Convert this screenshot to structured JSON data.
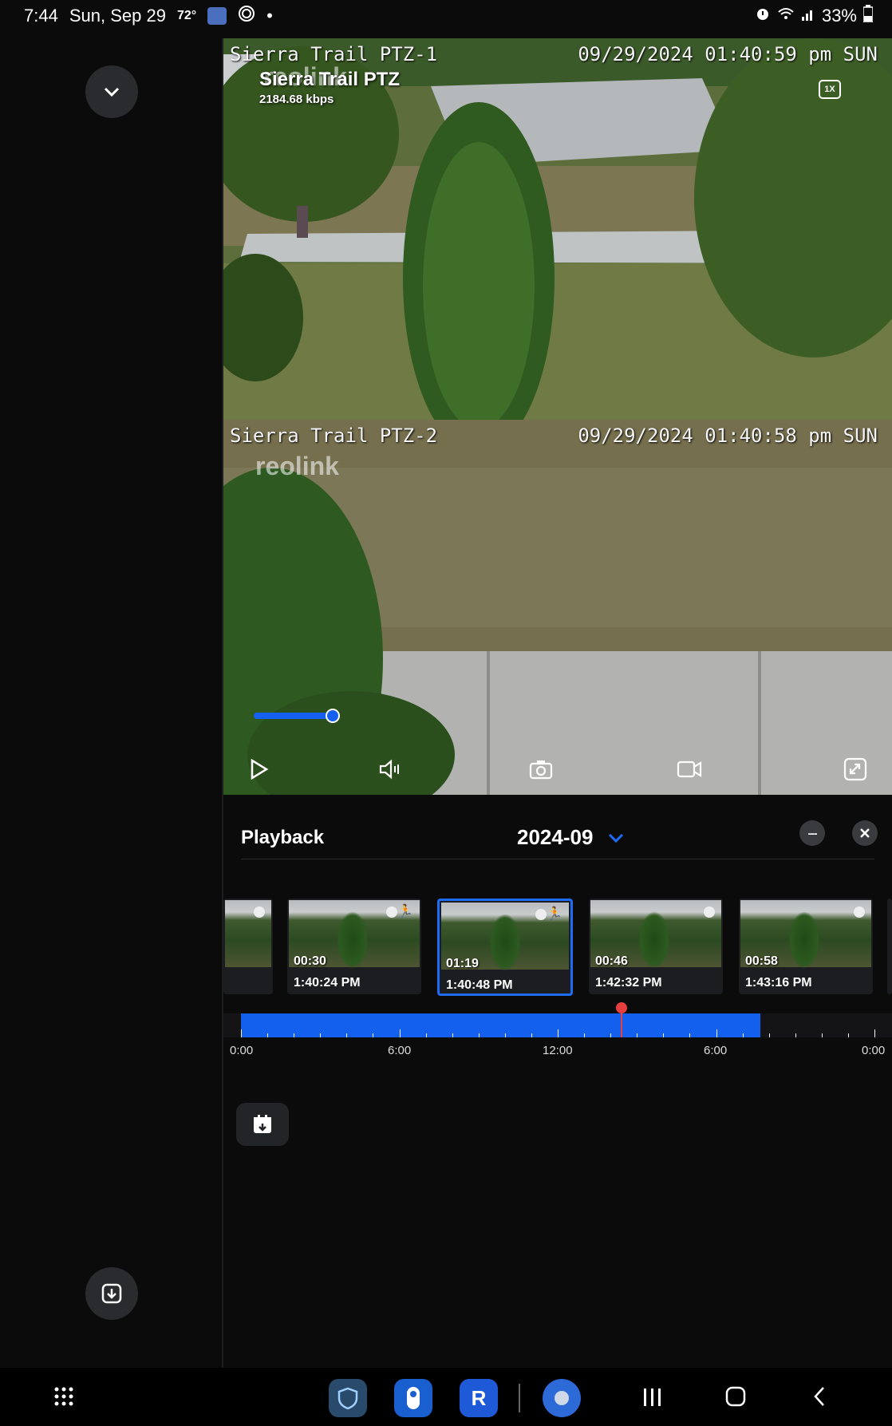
{
  "status": {
    "time": "7:44",
    "date": "Sun, Sep 29",
    "temp": "72°",
    "battery": "33%"
  },
  "cam1": {
    "osd_name": "Sierra Trail PTZ-1",
    "osd_time": "09/29/2024 01:40:59 pm SUN",
    "watermark": "reolink",
    "display_name": "Sierra Trail PTZ",
    "bitrate": "2184.68 kbps",
    "zoom": "1X"
  },
  "cam2": {
    "osd_name": "Sierra Trail PTZ-2",
    "osd_time": "09/29/2024 01:40:58 pm SUN",
    "watermark": "reolink"
  },
  "playback": {
    "title": "Playback",
    "month": "2024-09",
    "more_label": "---"
  },
  "clips": [
    {
      "duration": "00:30",
      "time": "1:40:24 PM",
      "motion": true
    },
    {
      "duration": "01:19",
      "time": "1:40:48 PM",
      "motion": true
    },
    {
      "duration": "00:46",
      "time": "1:42:32 PM",
      "motion": false
    },
    {
      "duration": "00:58",
      "time": "1:43:16 PM",
      "motion": false
    }
  ],
  "timeline": {
    "labels": [
      "0:00",
      "6:00",
      "12:00",
      "6:00",
      "0:00"
    ],
    "recorded_fraction": 0.82,
    "cursor_fraction": 0.6
  },
  "colors": {
    "accent": "#1e6cf5",
    "cursor": "#e53e3e",
    "background": "#0b0b0c"
  }
}
